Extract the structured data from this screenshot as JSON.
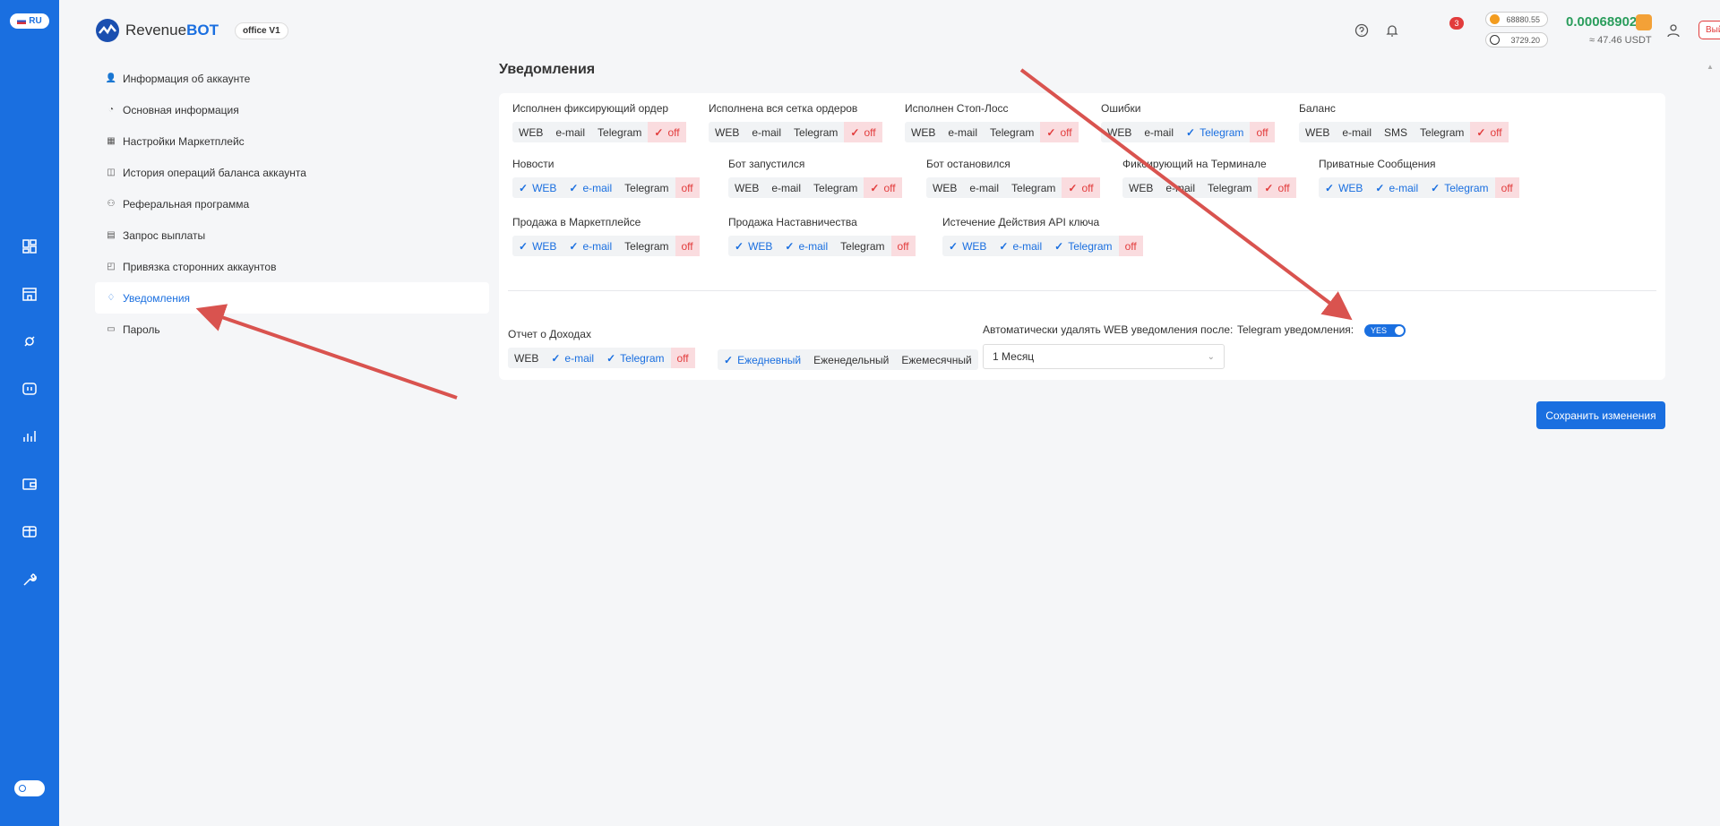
{
  "lang": "RU",
  "header": {
    "logo_main": "Revenue",
    "logo_bold": "BOT",
    "office": "office V1",
    "notif_count": "3",
    "btc_price": "68880.55",
    "eth_price": "3729.20",
    "balance": "0.00068902",
    "balance_usdt": "≈ 47.46 USDT",
    "logout": "Выйти"
  },
  "menu": [
    {
      "label": "Информация об аккаунте",
      "icon": "user-icon"
    },
    {
      "label": "Основная информация",
      "icon": "user-info-icon"
    },
    {
      "label": "Настройки Маркетплейс",
      "icon": "marketplace-settings-icon"
    },
    {
      "label": "История операций баланса аккаунта",
      "icon": "history-icon"
    },
    {
      "label": "Реферальная программа",
      "icon": "referral-icon"
    },
    {
      "label": "Запрос выплаты",
      "icon": "payout-icon"
    },
    {
      "label": "Привязка сторонних аккаунтов",
      "icon": "link-accounts-icon"
    },
    {
      "label": "Уведомления",
      "icon": "bell-icon",
      "active": true
    },
    {
      "label": "Пароль",
      "icon": "password-icon"
    }
  ],
  "page_title": "Уведомления",
  "groups": [
    {
      "title": "Исполнен фиксирующий ордер",
      "opts": [
        {
          "t": "WEB"
        },
        {
          "t": "e-mail"
        },
        {
          "t": "Telegram"
        },
        {
          "t": "off",
          "s": "offchk"
        }
      ]
    },
    {
      "title": "Исполнена вся сетка ордеров",
      "opts": [
        {
          "t": "WEB"
        },
        {
          "t": "e-mail"
        },
        {
          "t": "Telegram"
        },
        {
          "t": "off",
          "s": "offchk"
        }
      ]
    },
    {
      "title": "Исполнен Стоп-Лосс",
      "opts": [
        {
          "t": "WEB"
        },
        {
          "t": "e-mail"
        },
        {
          "t": "Telegram"
        },
        {
          "t": "off",
          "s": "offchk"
        }
      ]
    },
    {
      "title": "Ошибки",
      "opts": [
        {
          "t": "WEB"
        },
        {
          "t": "e-mail"
        },
        {
          "t": "Telegram",
          "s": "on"
        },
        {
          "t": "off",
          "s": "off"
        }
      ]
    },
    {
      "title": "Баланс",
      "opts": [
        {
          "t": "WEB"
        },
        {
          "t": "e-mail"
        },
        {
          "t": "SMS"
        },
        {
          "t": "Telegram"
        },
        {
          "t": "off",
          "s": "offchk"
        }
      ]
    },
    {
      "title": "Новости",
      "opts": [
        {
          "t": "WEB",
          "s": "on"
        },
        {
          "t": "e-mail",
          "s": "on"
        },
        {
          "t": "Telegram"
        },
        {
          "t": "off",
          "s": "off"
        }
      ]
    },
    {
      "title": "Бот запустился",
      "opts": [
        {
          "t": "WEB"
        },
        {
          "t": "e-mail"
        },
        {
          "t": "Telegram"
        },
        {
          "t": "off",
          "s": "offchk"
        }
      ]
    },
    {
      "title": "Бот остановился",
      "opts": [
        {
          "t": "WEB"
        },
        {
          "t": "e-mail"
        },
        {
          "t": "Telegram"
        },
        {
          "t": "off",
          "s": "offchk"
        }
      ]
    },
    {
      "title": "Фиксирующий на Терминале",
      "opts": [
        {
          "t": "WEB"
        },
        {
          "t": "e-mail"
        },
        {
          "t": "Telegram"
        },
        {
          "t": "off",
          "s": "offchk"
        }
      ]
    },
    {
      "title": "Приватные Сообщения",
      "opts": [
        {
          "t": "WEB",
          "s": "on"
        },
        {
          "t": "e-mail",
          "s": "on"
        },
        {
          "t": "Telegram",
          "s": "on"
        },
        {
          "t": "off",
          "s": "off"
        }
      ]
    },
    {
      "title": "Продажа в Маркетплейсе",
      "opts": [
        {
          "t": "WEB",
          "s": "on"
        },
        {
          "t": "e-mail",
          "s": "on"
        },
        {
          "t": "Telegram"
        },
        {
          "t": "off",
          "s": "off"
        }
      ]
    },
    {
      "title": "Продажа Наставничества",
      "opts": [
        {
          "t": "WEB",
          "s": "on"
        },
        {
          "t": "e-mail",
          "s": "on"
        },
        {
          "t": "Telegram"
        },
        {
          "t": "off",
          "s": "off"
        }
      ]
    },
    {
      "title": "Истечение Действия API ключа",
      "opts": [
        {
          "t": "WEB",
          "s": "on"
        },
        {
          "t": "e-mail",
          "s": "on"
        },
        {
          "t": "Telegram",
          "s": "on"
        },
        {
          "t": "off",
          "s": "off"
        }
      ]
    },
    {
      "title": "Отчет о Доходах",
      "opts": [
        {
          "t": "WEB"
        },
        {
          "t": "e-mail",
          "s": "on"
        },
        {
          "t": "Telegram",
          "s": "on"
        },
        {
          "t": "off",
          "s": "off"
        }
      ]
    },
    {
      "title": "",
      "opts": [
        {
          "t": "Ежедневный",
          "s": "on"
        },
        {
          "t": "Еженедельный"
        },
        {
          "t": "Ежемесячный"
        }
      ]
    }
  ],
  "auto_delete_label": "Автоматически удалять WEB уведомления после:",
  "auto_delete_value": "1 Месяц",
  "telegram_label": "Telegram уведомления:",
  "telegram_toggle": "YES",
  "save_label": "Сохранить изменения"
}
